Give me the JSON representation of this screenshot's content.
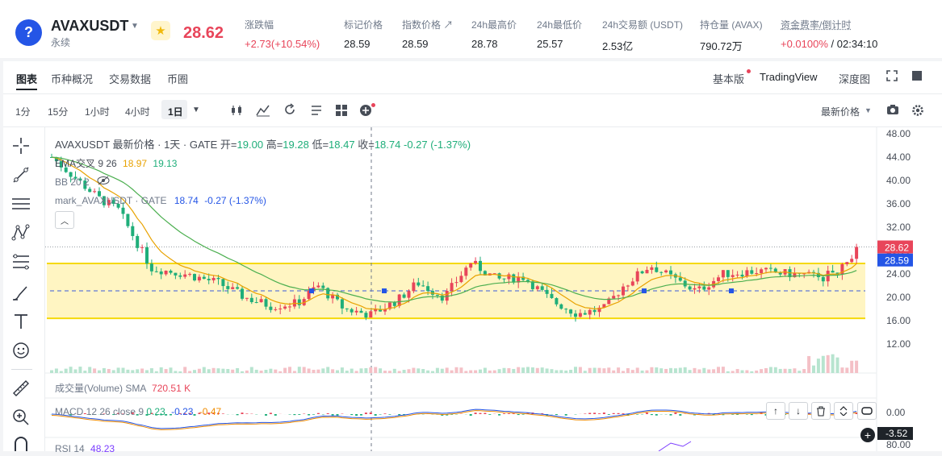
{
  "header": {
    "coin_icon_glyph": "?",
    "symbol": "AVAXUSDT",
    "contract_type": "永续",
    "last_price": "28.62",
    "stats": [
      {
        "label": "涨跌幅",
        "value": "+2.73(+10.54%)",
        "tone": "red"
      },
      {
        "label": "标记价格",
        "value": "28.59",
        "tone": "dark"
      },
      {
        "label": "指数价格 ↗",
        "value": "28.59",
        "tone": "dark"
      },
      {
        "label": "24h最高价",
        "value": "28.78",
        "tone": "dark"
      },
      {
        "label": "24h最低价",
        "value": "25.57",
        "tone": "dark"
      },
      {
        "label": "24h交易额 (USDT)",
        "value": "2.53亿",
        "tone": "dark"
      },
      {
        "label": "持仓量 (AVAX)",
        "value": "790.72万",
        "tone": "dark"
      }
    ],
    "funding": {
      "label": "资金费率/倒计时",
      "rate": "+0.0100%",
      "countdown": "/ 02:34:10"
    }
  },
  "tabs": {
    "left": [
      "图表",
      "币种概况",
      "交易数据",
      "币圈"
    ],
    "right": [
      "基本版",
      "TradingView",
      "深度图"
    ]
  },
  "toolbar": {
    "timeframes": [
      "1分",
      "15分",
      "1小时",
      "4小时",
      "1日"
    ],
    "active_timeframe": "1日",
    "price_type": "最新价格"
  },
  "chart": {
    "main_title": "AVAXUSDT 最新价格 · 1天 · GATE",
    "ohlc": {
      "open_label": "开=",
      "open": "19.00",
      "high_label": "高=",
      "high": "19.28",
      "low_label": "低=",
      "low": "18.47",
      "close_label": "收=",
      "close": "18.74",
      "change": "-0.27 (-1.37%)"
    },
    "ema": {
      "label": "EMA交叉 9 26",
      "v1": "18.97",
      "v2": "19.13"
    },
    "bb": {
      "label": "BB 20 2"
    },
    "mark": {
      "label": "mark_AVAXUSDT · GATE",
      "value": "18.74",
      "change": "-0.27 (-1.37%)"
    },
    "volume": {
      "label": "成交量(Volume) SMA",
      "value": "720.51 K"
    },
    "macd": {
      "label": "MACD 12 26 close 9",
      "v1": "0.23",
      "v2": "-0.23",
      "v3": "-0.47"
    },
    "rsi": {
      "label": "RSI 14",
      "value": "48.23"
    },
    "price_axis": [
      "48.00",
      "44.00",
      "40.00",
      "36.00",
      "32.00",
      "28.00",
      "24.00",
      "20.00",
      "16.00",
      "12.00"
    ],
    "last_price_tag": "28.62",
    "mark_price_tag": "28.59",
    "macd_axis": "0.00",
    "macd_tag": "-3.52",
    "rsi_axis": "80.00",
    "colors": {
      "up": "#e8455a",
      "down": "#1fae7a",
      "band": "#fff5c2",
      "band_line": "#f5d90a"
    }
  }
}
